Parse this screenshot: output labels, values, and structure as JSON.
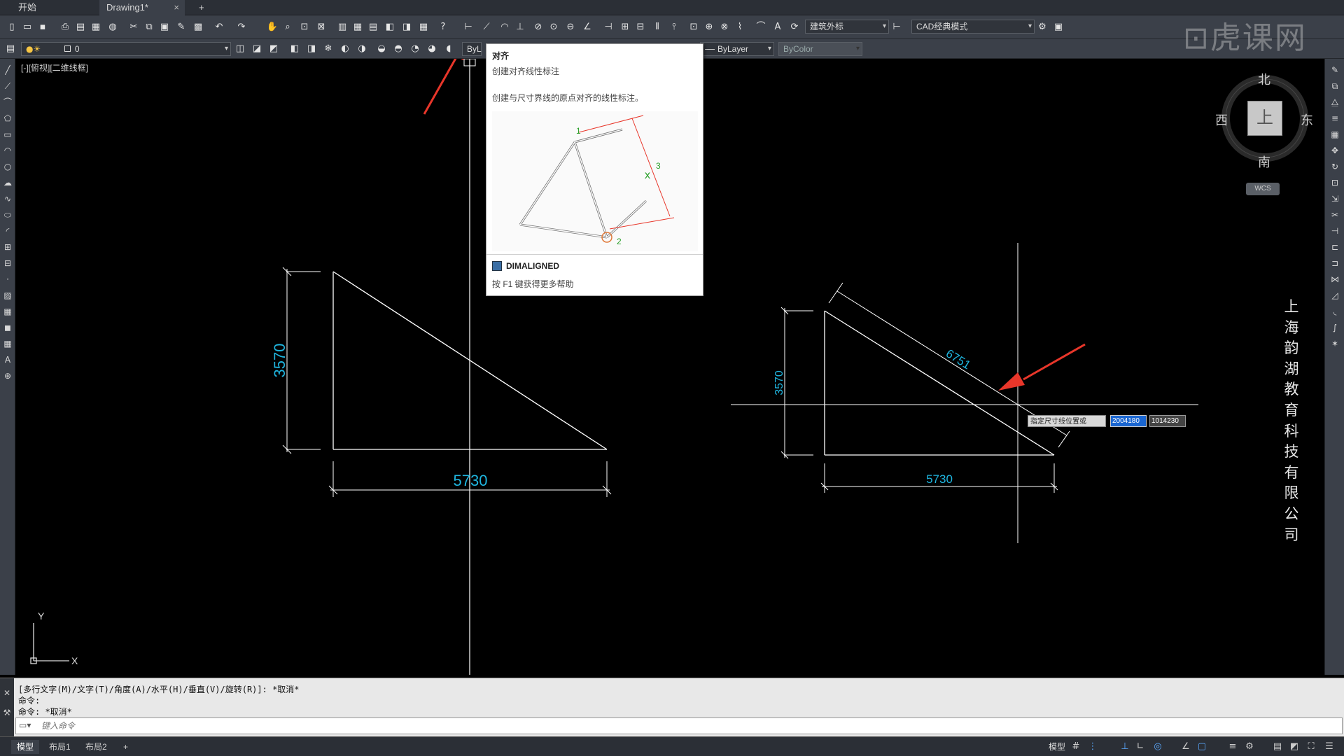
{
  "tabs": [
    {
      "label": "开始",
      "active": false
    },
    {
      "label": "Drawing1*",
      "active": true
    }
  ],
  "tab_add": "+",
  "tab_close": "×",
  "toolbar": {
    "dimstyle_combo": "建筑外标",
    "workspace_combo": "CAD经典模式",
    "layer_combo": "0",
    "linetype_combo": "ByLayer",
    "lineweight_combo": "ByColor",
    "layer_color_combo": "ByL"
  },
  "view_label": "[-][俯视][二维线框]",
  "tooltip": {
    "title": "对齐",
    "subtitle": "创建对齐线性标注",
    "description": "创建与尺寸界线的原点对齐的线性标注。",
    "command": "DIMALIGNED",
    "help": "按 F1 键获得更多帮助",
    "diagram_labels": [
      "1",
      "2",
      "3"
    ]
  },
  "viewcube": {
    "north": "北",
    "south": "南",
    "east": "东",
    "west": "西",
    "face": "上",
    "wcs": "WCS"
  },
  "drawing": {
    "left_triangle": {
      "vertical_dim": "3570",
      "horizontal_dim": "5730"
    },
    "right_triangle": {
      "vertical_dim": "3570",
      "horizontal_dim": "5730",
      "aligned_dim": "6751"
    },
    "dim_color": "#1fb6e0",
    "line_color": "#ffffff",
    "arrow_color": "#e8362a"
  },
  "dynamic_input": {
    "prompt": "指定尺寸线位置或",
    "x_value": "2004180",
    "y_value": "1014230"
  },
  "watermark": "虎课网",
  "company_vertical": "上海韵湖教育科技有限公司",
  "command_history": [
    "[多行文字(M)/文字(T)/角度(A)/水平(H)/垂直(V)/旋转(R)]: *取消*",
    "命令:",
    "命令: *取消*"
  ],
  "command_placeholder": "键入命令",
  "layouts": [
    {
      "label": "模型",
      "active": true
    },
    {
      "label": "布局1",
      "active": false
    },
    {
      "label": "布局2",
      "active": false
    }
  ],
  "layout_add": "+",
  "status": {
    "model_label": "模型"
  },
  "ucs": {
    "x": "X",
    "y": "Y"
  }
}
